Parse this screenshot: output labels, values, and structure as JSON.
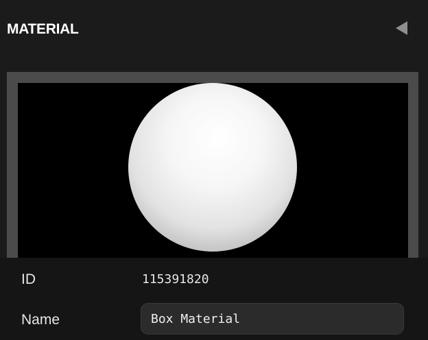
{
  "panel": {
    "title": "MATERIAL",
    "collapse_icon": "triangle-left-icon"
  },
  "preview": {
    "subject": "sphere",
    "background_color": "#000000",
    "frame_color": "#4b4b4b"
  },
  "fields": {
    "id_label": "ID",
    "id_value": "115391820",
    "name_label": "Name",
    "name_value": "Box Material"
  }
}
